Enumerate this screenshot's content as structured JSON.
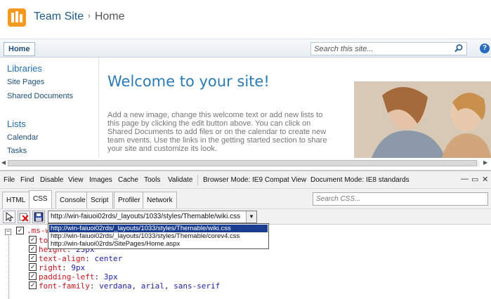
{
  "site": {
    "title": "Team Site",
    "breadcrumb_current": "Home",
    "breadcrumb_sep": "›",
    "nav_home": "Home",
    "search_placeholder": "Search this site...",
    "help": "?"
  },
  "leftnav": {
    "libraries_heading": "Libraries",
    "libraries": [
      "Site Pages",
      "Shared Documents"
    ],
    "lists_heading": "Lists",
    "lists": [
      "Calendar",
      "Tasks"
    ]
  },
  "main": {
    "heading": "Welcome to your site!",
    "body": "Add a new image, change this welcome text or add new lists to this page by clicking the edit button above. You can click on Shared Documents to add files or on the calendar to create new team events. Use the links in the getting started section to share your site and customize its look."
  },
  "devtools": {
    "menu": [
      "File",
      "Find",
      "Disable",
      "View",
      "Images",
      "Cache",
      "Tools",
      "Validate"
    ],
    "browser_mode": "Browser Mode: IE9 Compat View",
    "document_mode": "Document Mode: IE8 standards",
    "window_buttons": [
      "—",
      "▭",
      "✕"
    ],
    "tabs": [
      "HTML",
      "CSS",
      "Console",
      "Script",
      "Profiler",
      "Network"
    ],
    "active_tab": "CSS",
    "search_placeholder": "Search CSS...",
    "stylesheet_selected": "http://win-faiuoi02rds/_layouts/1033/styles/Themable/wiki.css",
    "stylesheet_options": [
      "http://win-faiuoi02rds/_layouts/1033/styles/Themable/wiki.css",
      "http://win-faiuoi02rds/_layouts/1033/styles/Themable/corev4.css",
      "http://win-faiuoi02rds/SitePages/Home.aspx"
    ],
    "rule_selector_visible": ".ms-w",
    "declarations": [
      {
        "prop": "top",
        "sep": ": ",
        "val": ""
      },
      {
        "prop": "height",
        "sep": ": ",
        "val": "23px"
      },
      {
        "prop": "text-align",
        "sep": ": ",
        "val": "center"
      },
      {
        "prop": "right",
        "sep": ": ",
        "val": "9px"
      },
      {
        "prop": "padding-left",
        "sep": ": ",
        "val": "3px"
      },
      {
        "prop": "font-family",
        "sep": ": ",
        "val": "verdana, arial, sans-serif"
      }
    ]
  }
}
